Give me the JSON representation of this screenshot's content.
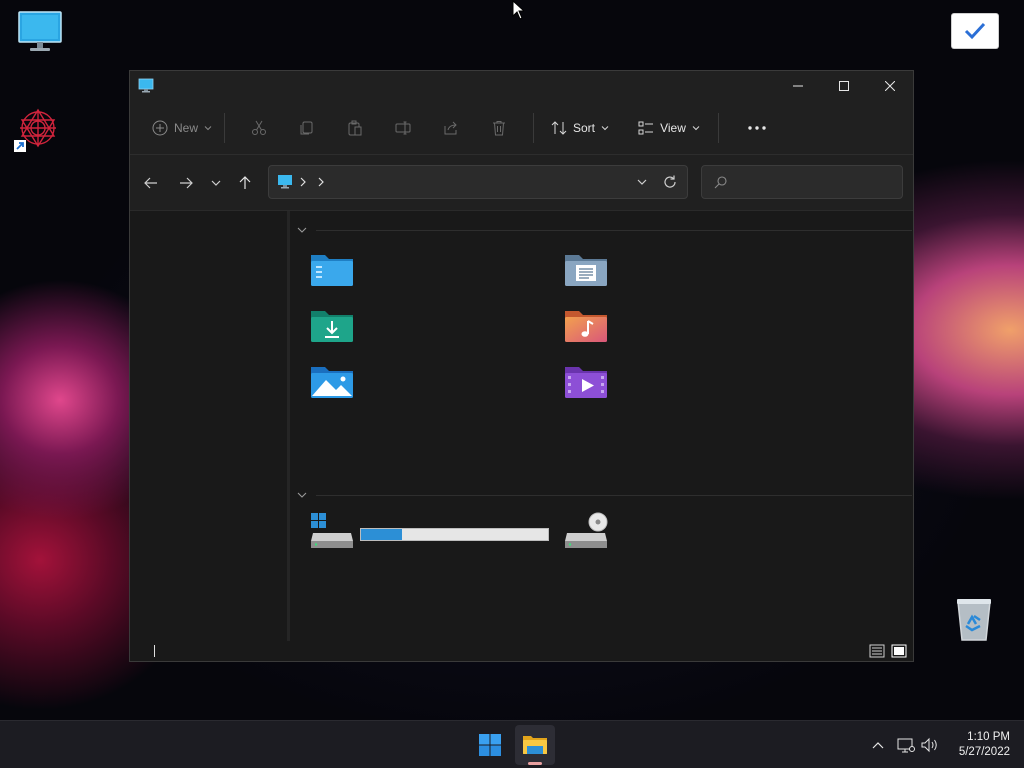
{
  "desktop": {
    "icons": [
      {
        "name": "this-pc",
        "icon": "monitor-icon"
      },
      {
        "name": "app-shortcut",
        "icon": "mandala-shortcut-icon"
      },
      {
        "name": "recycle-bin",
        "icon": "recycle-bin-icon"
      }
    ],
    "checkbox_widget": {
      "icon": "checkmark-icon",
      "color": "#2b6fd6"
    }
  },
  "window": {
    "title_icon": "this-pc-icon",
    "controls": [
      "minimize-icon",
      "maximize-icon",
      "close-icon"
    ],
    "commandbar": {
      "new_label": "New",
      "sort_label": "Sort",
      "view_label": "View",
      "icons": [
        "new-plus-icon",
        "cut-icon",
        "copy-icon",
        "paste-icon",
        "rename-icon",
        "share-icon",
        "delete-icon",
        "sort-icon",
        "view-icon",
        "more-icon"
      ]
    },
    "navigation": {
      "icons": [
        "back-arrow-icon",
        "forward-arrow-icon",
        "recent-dropdown-icon",
        "up-arrow-icon"
      ],
      "address_icon": "this-pc-icon",
      "address_text": "",
      "search_placeholder": ""
    },
    "content": {
      "folders_group_label": "",
      "folders": [
        {
          "name": "desktop-folder",
          "icon": "desktop-folder-icon",
          "color": "#2f9be0"
        },
        {
          "name": "documents-folder",
          "icon": "documents-folder-icon",
          "color": "#7d9bb8"
        },
        {
          "name": "downloads-folder",
          "icon": "downloads-folder-icon",
          "color": "#1ea58a"
        },
        {
          "name": "music-folder",
          "icon": "music-folder-icon",
          "color": "#e9805b"
        },
        {
          "name": "pictures-folder",
          "icon": "pictures-folder-icon",
          "color": "#2d9ae6"
        },
        {
          "name": "videos-folder",
          "icon": "videos-folder-icon",
          "color": "#8d4fd6"
        }
      ],
      "drives_group_label": "",
      "drives": [
        {
          "name": "local-disk",
          "icon": "windows-drive-icon",
          "usage": 0.22,
          "usage_color": "#2c8fd6"
        },
        {
          "name": "dvd-drive",
          "icon": "optical-drive-icon"
        }
      ]
    },
    "statusbar": {
      "status_text": "",
      "view_icons": [
        "details-view-icon",
        "tiles-view-icon"
      ]
    }
  },
  "taskbar": {
    "pinned": [
      {
        "name": "start",
        "icon": "windows-start-icon"
      },
      {
        "name": "file-explorer",
        "icon": "file-explorer-icon",
        "active": true
      }
    ],
    "tray_icons": [
      "show-hidden-icons-chevron",
      "network-icon",
      "volume-icon"
    ],
    "clock": {
      "time": "1:10 PM",
      "date": "5/27/2022"
    }
  }
}
